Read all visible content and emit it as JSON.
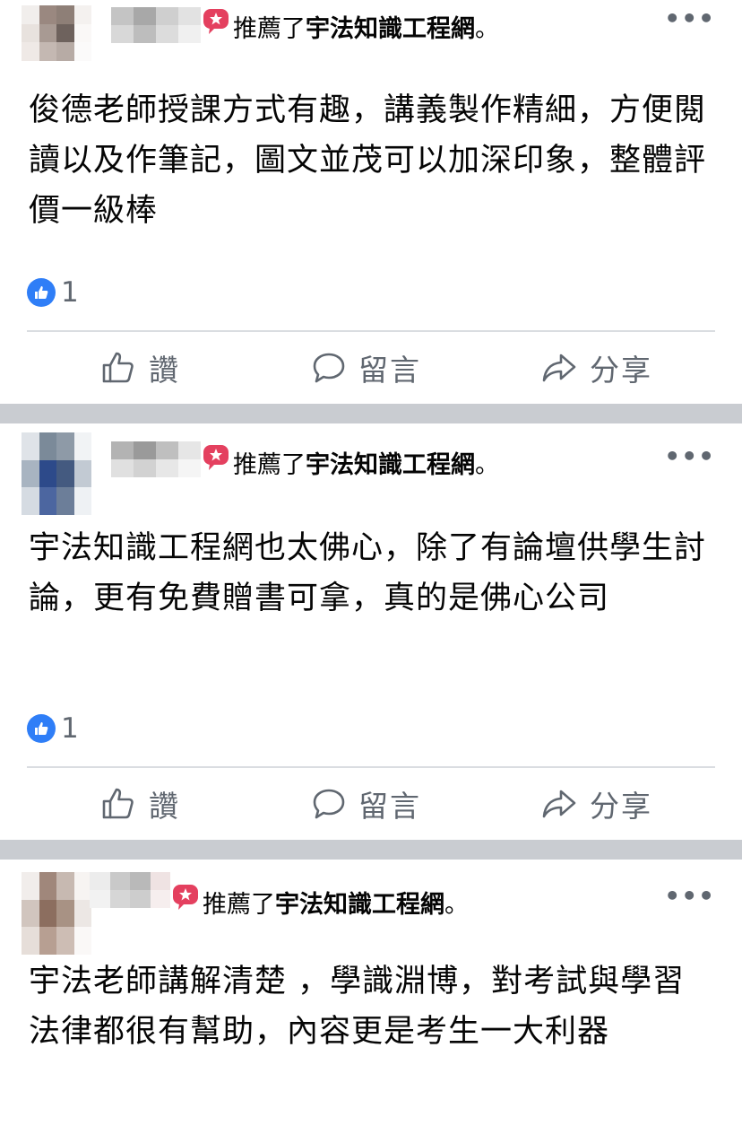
{
  "posts": [
    {
      "recommend_verb": "推薦了",
      "page_name": "宇法知識工程網",
      "page_suffix": "。",
      "text": "俊德老師授課方式有趣，講義製作精細，方便閱讀以及作筆記，圖文並茂可以加深印象，整體評價一級棒",
      "like_count": "1"
    },
    {
      "recommend_verb": "推薦了",
      "page_name": "宇法知識工程網",
      "page_suffix": "。",
      "text": "宇法知識工程網也太佛心，除了有論壇供學生討論，更有免費贈書可拿，真的是佛心公司",
      "like_count": "1"
    },
    {
      "recommend_verb": "推薦了",
      "page_name": "宇法知識工程網",
      "page_suffix": "。",
      "text": "宇法老師講解清楚 ，學識淵博，對考試與學習法律都很有幫助，內容更是考生一大利器"
    }
  ],
  "actions": {
    "like_label": "讚",
    "comment_label": "留言",
    "share_label": "分享"
  },
  "colors": {
    "recommend_badge": "#e4405f",
    "like_blue": "#2f7ef7",
    "muted_text": "#606770",
    "separator": "#c9ccd1"
  }
}
